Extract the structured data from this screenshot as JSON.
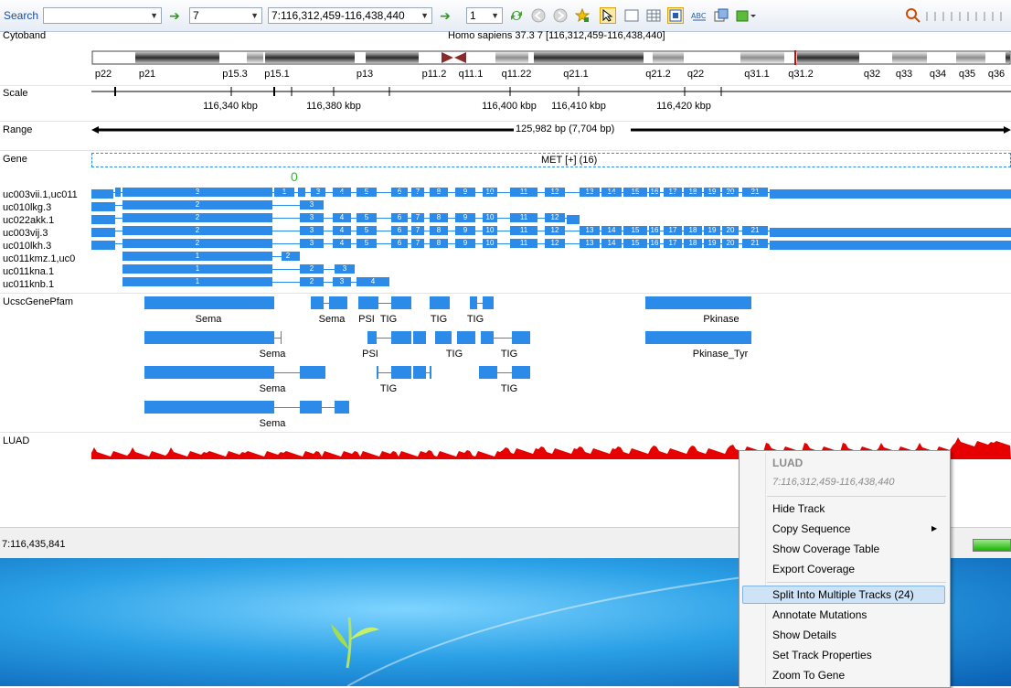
{
  "toolbar": {
    "search_label": "Search",
    "search_value": "",
    "chromosome_value": "7",
    "locus_value": "7:116,312,459-116,438,440",
    "page_value": "1"
  },
  "cytoband": {
    "label": "Cytoband",
    "title": "Homo sapiens 37.3 7 [116,312,459-116,438,440]",
    "bands": [
      "p22",
      "p21",
      "p15.3",
      "p15.1",
      "p13",
      "p11.2",
      "q11.1",
      "q11.22",
      "q21.1",
      "q21.2",
      "q22",
      "q31.1",
      "q31.2",
      "q32",
      "q33",
      "q34",
      "q35",
      "q36"
    ]
  },
  "scale": {
    "label": "Scale",
    "ticks": [
      "116,340 kbp",
      "116,380 kbp",
      "116,400 kbp",
      "116,410 kbp",
      "116,420 kbp"
    ]
  },
  "range": {
    "label": "Range",
    "text": "125,982 bp (7,704 bp)"
  },
  "gene": {
    "label": "Gene",
    "text": "MET [+] (16)",
    "small_marker": "0"
  },
  "transcripts": [
    {
      "name": "uc003vii.1,uc011"
    },
    {
      "name": "uc010lkg.3"
    },
    {
      "name": "uc022akk.1"
    },
    {
      "name": "uc003vij.3"
    },
    {
      "name": "uc010lkh.3"
    },
    {
      "name": "uc011kmz.1,uc0"
    },
    {
      "name": "uc011kna.1"
    },
    {
      "name": "uc011knb.1"
    }
  ],
  "pfam": {
    "label": "UcscGenePfam",
    "labels": [
      "Sema",
      "Sema",
      "PSI",
      "TIG",
      "TIG",
      "TIG",
      "Pkinase",
      "Sema",
      "PSI",
      "TIG",
      "TIG",
      "Pkinase_Tyr",
      "Sema",
      "TIG",
      "TIG",
      "Sema"
    ]
  },
  "luad": {
    "label": "LUAD"
  },
  "status": {
    "coordinate": "7:116,435,841"
  },
  "context_menu": {
    "header": "LUAD",
    "subheader": "7:116,312,459-116,438,440",
    "items": [
      "Hide Track",
      "Copy Sequence",
      "Show Coverage Table",
      "Export Coverage",
      "Split Into Multiple Tracks (24)",
      "Annotate Mutations",
      "Show Details",
      "Set Track Properties",
      "Zoom To Gene"
    ],
    "highlighted_index": 4,
    "submenu_arrow": "▶"
  },
  "colors": {
    "exon": "#2c8ae8",
    "coverage": "#e60000",
    "highlight": "#cfe3f7",
    "marker_green": "#22c022"
  }
}
